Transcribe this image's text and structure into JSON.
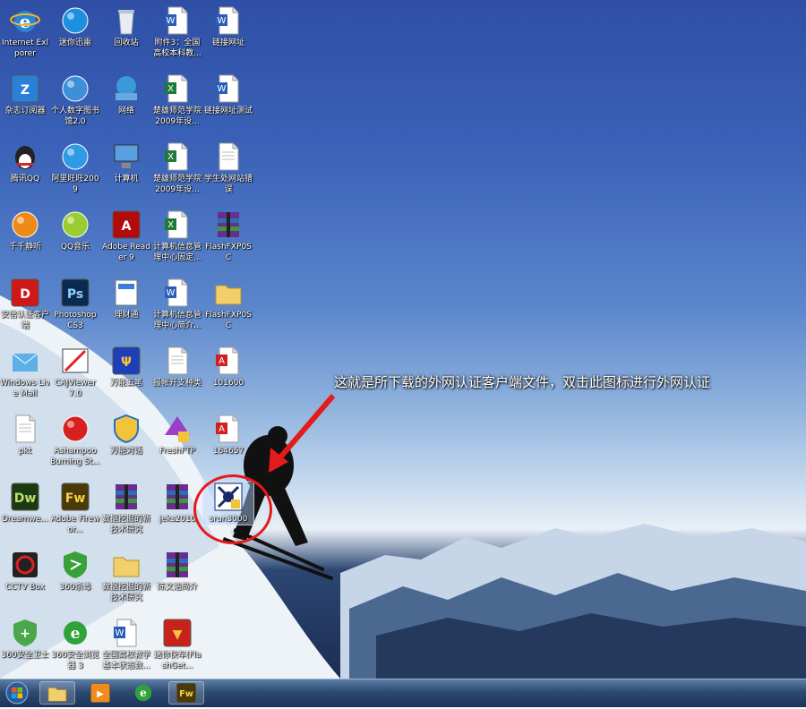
{
  "desktop": {
    "annotation": "这就是所下载的外网认证客户端文件，双击此图标进行外网认证",
    "icons": [
      {
        "label": "Internet Exlporer",
        "kind": "ie"
      },
      {
        "label": "迷你迅雷",
        "kind": "thunder"
      },
      {
        "label": "回收站",
        "kind": "recycle"
      },
      {
        "label": "附件3：全国高校本科教...",
        "kind": "word"
      },
      {
        "label": "链接网址",
        "kind": "word"
      },
      {
        "label": "杂志订阅器",
        "kind": "zine"
      },
      {
        "label": "个人数字图书馆2.0",
        "kind": "globe"
      },
      {
        "label": "网络",
        "kind": "network"
      },
      {
        "label": "楚雄师范学院2009年设...",
        "kind": "excel"
      },
      {
        "label": "链接网址测试",
        "kind": "word"
      },
      {
        "label": "腾讯QQ",
        "kind": "qq"
      },
      {
        "label": "阿里旺旺2009",
        "kind": "wangwang"
      },
      {
        "label": "计算机",
        "kind": "computer"
      },
      {
        "label": "楚雄师范学院2009年设...",
        "kind": "excel"
      },
      {
        "label": "学生处网站错误",
        "kind": "doc"
      },
      {
        "label": "千千静听",
        "kind": "ttplayer"
      },
      {
        "label": "QQ音乐",
        "kind": "qqmusic"
      },
      {
        "label": "Adobe Reader 9",
        "kind": "pdf"
      },
      {
        "label": "计算机信息管理中心固定...",
        "kind": "excel"
      },
      {
        "label": "FlashFXP0SC",
        "kind": "rar"
      },
      {
        "label": "安信认证客户端",
        "kind": "auth"
      },
      {
        "label": "Photoshop CS3",
        "kind": "ps"
      },
      {
        "label": "理财通",
        "kind": "calc"
      },
      {
        "label": "计算机信息管理中心简介...",
        "kind": "word"
      },
      {
        "label": "FlashFXP0SC",
        "kind": "folder"
      },
      {
        "label": "Windows Live Mail",
        "kind": "mail"
      },
      {
        "label": "CAJViewer 7.0",
        "kind": "caj"
      },
      {
        "label": "万能五笔",
        "kind": "wubi"
      },
      {
        "label": "报帐开支种类",
        "kind": "doc"
      },
      {
        "label": "101600",
        "kind": "pdfdoc"
      },
      {
        "label": "pkt",
        "kind": "doc"
      },
      {
        "label": "Ashampoo Burning St...",
        "kind": "ashampoo"
      },
      {
        "label": "万能对话",
        "kind": "shield"
      },
      {
        "label": "FreshFTP",
        "kind": "freshftp"
      },
      {
        "label": "164657",
        "kind": "pdfdoc"
      },
      {
        "label": "Dreamwe...",
        "kind": "dw"
      },
      {
        "label": "Adobe Firewor...",
        "kind": "fw"
      },
      {
        "label": "数据挖掘的新技术研究",
        "kind": "rar"
      },
      {
        "label": "jeks2010",
        "kind": "rar"
      },
      {
        "label": "srun3000",
        "kind": "srun"
      },
      {
        "label": "CCTV Box",
        "kind": "cctv"
      },
      {
        "label": "360杀毒",
        "kind": "360sd"
      },
      {
        "label": "数据挖掘的新技术研究",
        "kind": "folder"
      },
      {
        "label": "陈文浩简介",
        "kind": "rar"
      },
      {
        "label": "360安全卫士",
        "kind": "360ws"
      },
      {
        "label": "360安全浏览器 3",
        "kind": "360se"
      },
      {
        "label": "全国高校教学基本状态数...",
        "kind": "word"
      },
      {
        "label": "迷你快车(FlashGet...",
        "kind": "flashget"
      }
    ]
  },
  "taskbar": {
    "items": [
      {
        "name": "explorer",
        "kind": "folder"
      },
      {
        "name": "media-player",
        "kind": "wmp"
      },
      {
        "name": "browser",
        "kind": "360se"
      },
      {
        "name": "fireworks",
        "kind": "fw"
      }
    ]
  },
  "colors": {
    "accent": "#e51b1b"
  }
}
